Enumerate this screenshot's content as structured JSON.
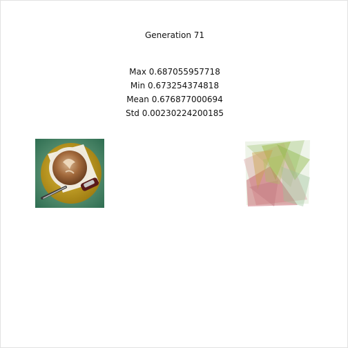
{
  "header": {
    "generation_label": "Generation 71"
  },
  "stats": {
    "max": "Max 0.687055957718",
    "min": "Min 0.673254374818",
    "mean": "Mean 0.676877000694",
    "std": "Std 0.00230224200185"
  },
  "images": {
    "target_icon": "coffee-cup-photo",
    "evolved_icon": "polygon-approximation"
  },
  "colors": {
    "target_bg": "#4f8f6d",
    "saucer": "#c9a21f",
    "cup_rim": "#f2efe6",
    "coffee": "#8a5a32",
    "polygon_green": "#8fb84a",
    "polygon_red": "#c4606a"
  }
}
